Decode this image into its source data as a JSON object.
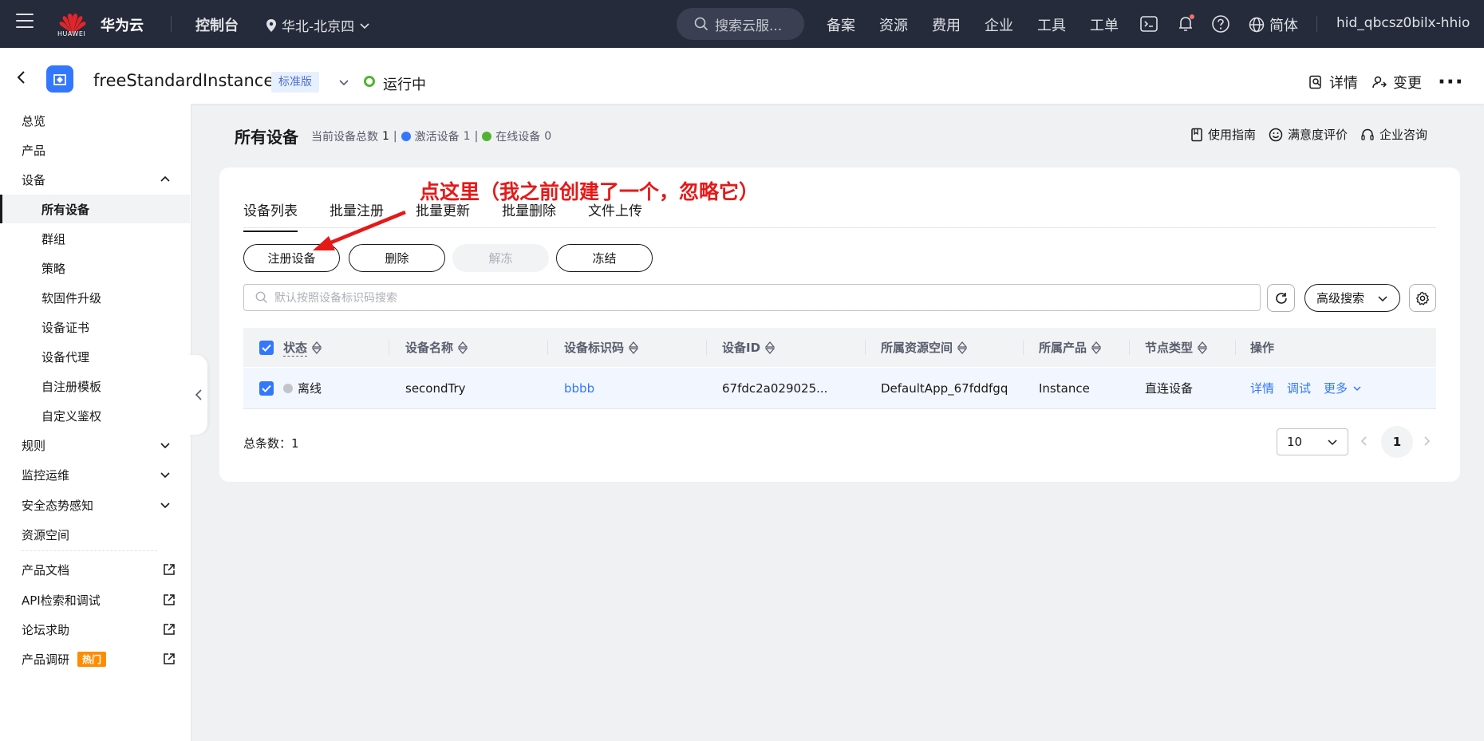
{
  "topnav": {
    "brand_logo_text": "HUAWEI",
    "brand_name": "华为云",
    "console": "控制台",
    "region": "华北-北京四",
    "search_placeholder": "搜索云服...",
    "links": [
      "备案",
      "资源",
      "费用",
      "企业",
      "工具",
      "工单"
    ],
    "lang": "简体",
    "username": "hid_qbcsz0bilx-hhio"
  },
  "instance": {
    "name": "freeStandardInstance",
    "edition": "标准版",
    "status": "运行中",
    "detail_label": "详情",
    "change_label": "变更",
    "more_label": "···"
  },
  "sidebar": {
    "items": [
      {
        "label": "总览"
      },
      {
        "label": "产品"
      },
      {
        "label": "设备"
      },
      {
        "label": "所有设备"
      },
      {
        "label": "群组"
      },
      {
        "label": "策略"
      },
      {
        "label": "软固件升级"
      },
      {
        "label": "设备证书"
      },
      {
        "label": "设备代理"
      },
      {
        "label": "自注册模板"
      },
      {
        "label": "自定义鉴权"
      },
      {
        "label": "规则"
      },
      {
        "label": "监控运维"
      },
      {
        "label": "安全态势感知"
      },
      {
        "label": "资源空间"
      },
      {
        "label": "产品文档"
      },
      {
        "label": "API检索和调试"
      },
      {
        "label": "论坛求助"
      },
      {
        "label": "产品调研"
      }
    ],
    "hot_badge": "热门"
  },
  "page": {
    "title": "所有设备",
    "total_label": "当前设备总数",
    "total_value": "1",
    "active_label": "激活设备",
    "active_value": "1",
    "online_label": "在线设备",
    "online_value": "0",
    "guide": "使用指南",
    "rating": "满意度评价",
    "consult": "企业咨询"
  },
  "tabs": [
    "设备列表",
    "批量注册",
    "批量更新",
    "批量删除",
    "文件上传"
  ],
  "buttons": {
    "register": "注册设备",
    "delete": "删除",
    "unfreeze": "解冻",
    "freeze": "冻结",
    "advanced": "高级搜索"
  },
  "search": {
    "placeholder": "默认按照设备标识码搜索"
  },
  "table": {
    "headers": [
      "状态",
      "设备名称",
      "设备标识码",
      "设备ID",
      "所属资源空间",
      "所属产品",
      "节点类型",
      "操作"
    ],
    "rows": [
      {
        "status": "离线",
        "name": "secondTry",
        "identifier": "bbbb",
        "device_id": "67fdc2a029025...",
        "space": "DefaultApp_67fddfgq",
        "product": "Instance",
        "node_type": "直连设备",
        "actions": [
          "详情",
          "调试",
          "更多"
        ]
      }
    ]
  },
  "pagination": {
    "total_label": "总条数：",
    "total_value": "1",
    "page_size": "10",
    "current_page": "1"
  },
  "annotation": "点这里（我之前创建了一个，忽略它）",
  "colors": {
    "accent": "#3377ff",
    "annotation": "#e61919",
    "online": "#50b432",
    "nav_bg": "#252b3a"
  }
}
